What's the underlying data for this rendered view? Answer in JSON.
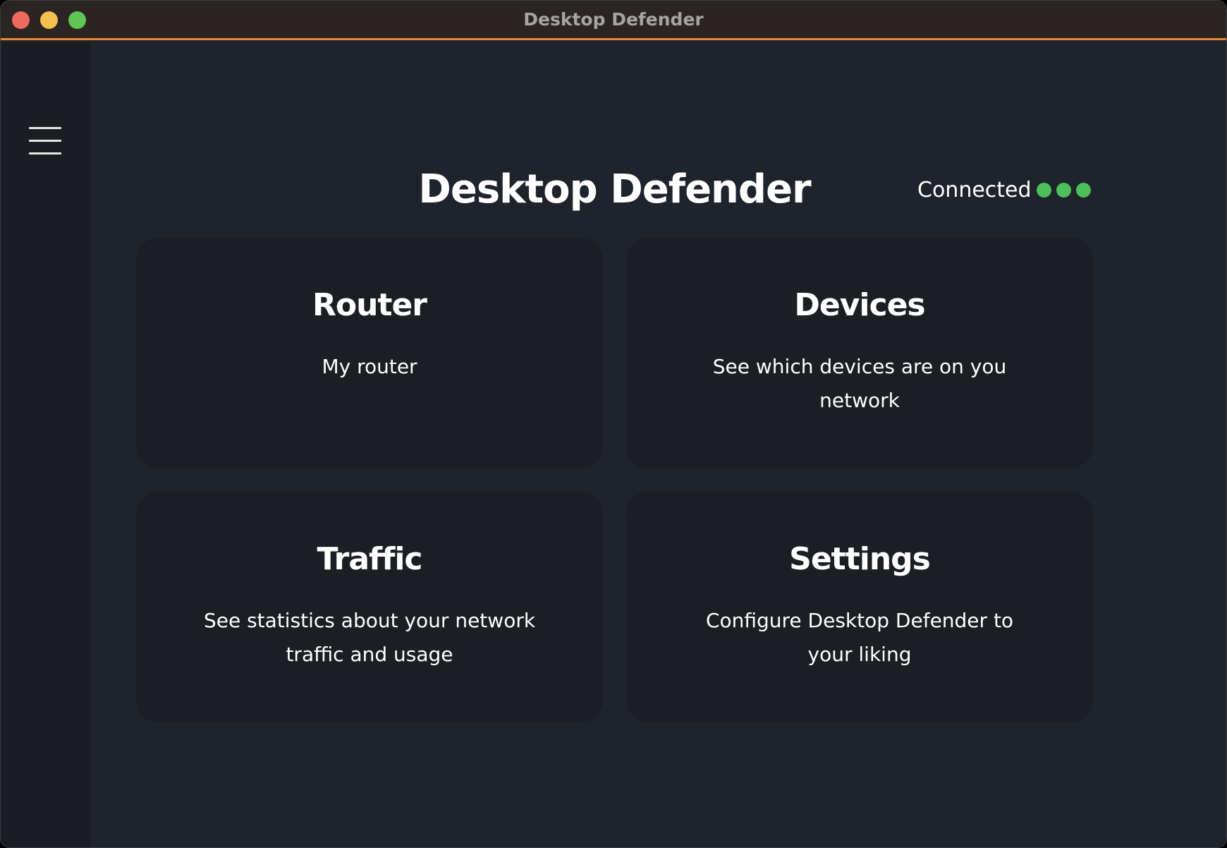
{
  "window": {
    "title": "Desktop Defender"
  },
  "colors": {
    "accent": "#e8892f",
    "background": "#1f232b",
    "sidebar": "#1a1d22",
    "card": "#1b1e23",
    "status_dot": "#4cbe5a"
  },
  "sidebar": {
    "menu_icon": "hamburger-menu-icon"
  },
  "header": {
    "title": "Desktop Defender",
    "status": {
      "label": "Connected",
      "dot_count": 3
    }
  },
  "cards": [
    {
      "title": "Router",
      "description": "My router"
    },
    {
      "title": "Devices",
      "description": "See which devices are on you network"
    },
    {
      "title": "Traffic",
      "description": "See statistics about your network traffic and usage"
    },
    {
      "title": "Settings",
      "description": "Configure Desktop Defender to your liking"
    }
  ]
}
